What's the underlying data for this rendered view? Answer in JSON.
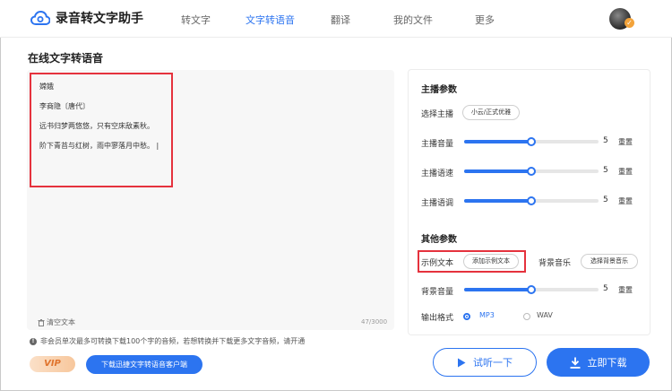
{
  "app": {
    "title": "录音转文字助手"
  },
  "nav": {
    "items": [
      {
        "label": "转文字",
        "active": false
      },
      {
        "label": "文字转语音",
        "active": true
      },
      {
        "label": "翻译",
        "active": false
      },
      {
        "label": "我的文件",
        "active": false
      },
      {
        "label": "更多",
        "active": false
      }
    ]
  },
  "page": {
    "title": "在线文字转语音"
  },
  "editor": {
    "text": "嫦娥\n\n李商隐〔唐代〕\n\n远书归梦两悠悠，只有空床敌素秋。\n\n阶下青苔与红树，雨中寥落月中愁。 |",
    "clear_label": "清空文本",
    "char_count": "47/3000"
  },
  "notice": {
    "text": "非会员单次最多可转换下载100个字的音频，若想转换并下载更多文字音频，请开通"
  },
  "bottom_left": {
    "vip_label": "VIP",
    "download_client_label": "下载迅捷文字转语音客户端"
  },
  "anchor_params": {
    "title": "主播参数",
    "select_label": "选择主播",
    "selected_anchor": "小云/正式优雅",
    "sliders": [
      {
        "label": "主播音量",
        "value": "5",
        "level": 0.5,
        "reset": "重置"
      },
      {
        "label": "主播语速",
        "value": "5",
        "level": 0.5,
        "reset": "重置"
      },
      {
        "label": "主播语调",
        "value": "5",
        "level": 0.5,
        "reset": "重置"
      }
    ]
  },
  "other_params": {
    "title": "其他参数",
    "sample_label": "示例文本",
    "sample_button": "添加示例文本",
    "bgm_label": "背景音乐",
    "bgm_button": "选择背景音乐",
    "bg_volume": {
      "label": "背景音量",
      "value": "5",
      "level": 0.5,
      "reset": "重置"
    },
    "format_label": "输出格式",
    "formats": [
      {
        "label": "MP3",
        "selected": true
      },
      {
        "label": "WAV",
        "selected": false
      }
    ]
  },
  "actions": {
    "preview_label": "试听一下",
    "download_label": "立即下载"
  },
  "colors": {
    "accent": "#2c74f0",
    "highlight_box": "#e5323d"
  }
}
